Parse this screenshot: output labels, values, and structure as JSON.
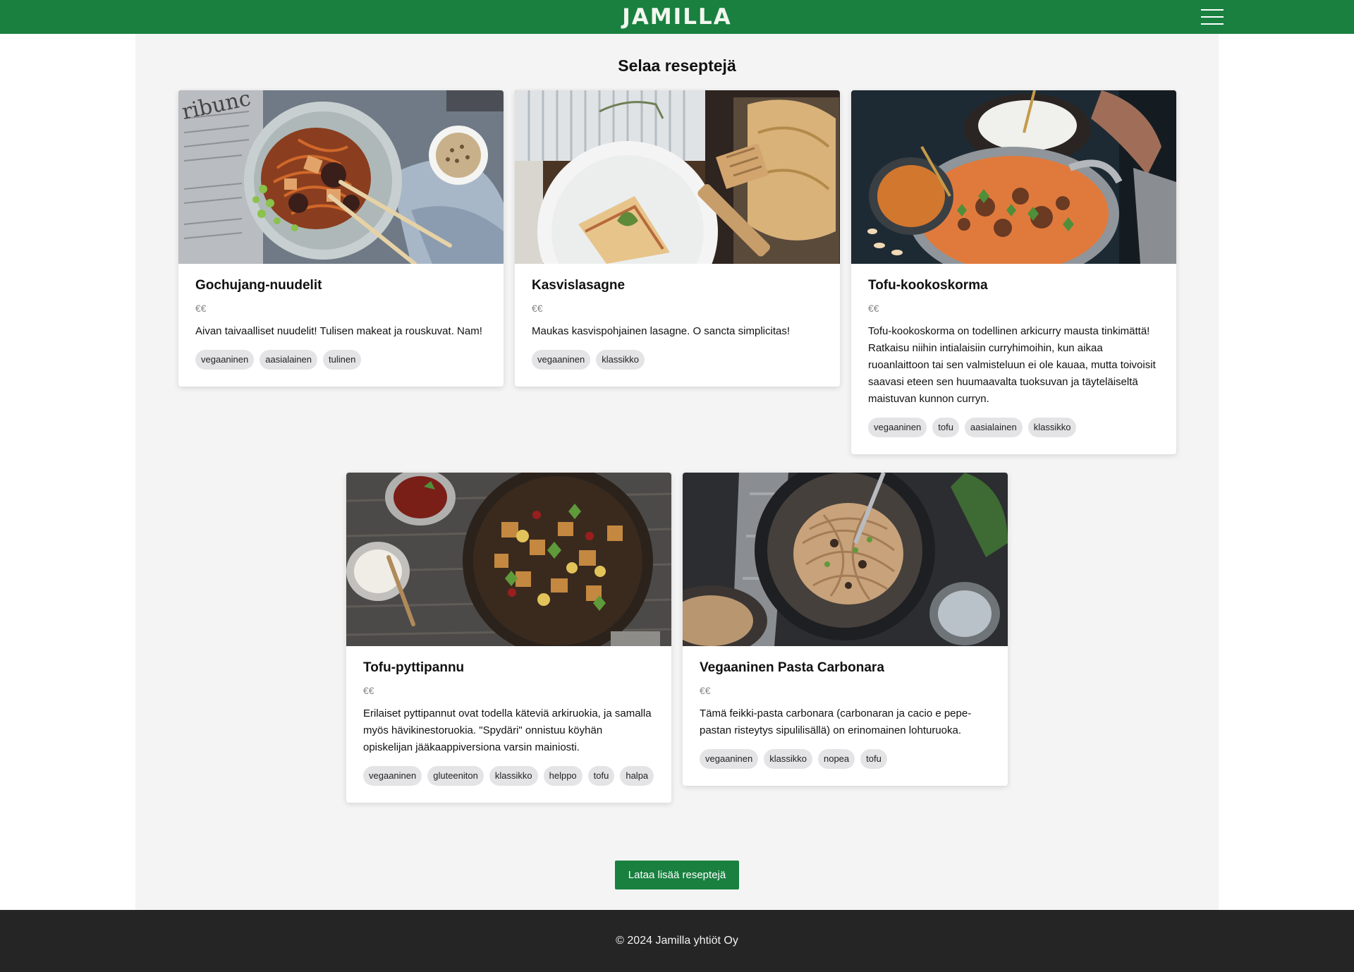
{
  "header": {
    "logo": "JAMILLA",
    "menu_icon": "hamburger-menu-icon",
    "background": "#198040"
  },
  "main": {
    "title": "Selaa reseptejä",
    "load_more_label": "Lataa lisää reseptejä",
    "recipes": [
      {
        "title": "Gochujang-nuudelit",
        "price": "€€",
        "description": "Aivan taivaalliset nuudelit! Tulisen makeat ja rouskuvat. Nam!",
        "tags": [
          "vegaaninen",
          "aasialainen",
          "tulinen"
        ]
      },
      {
        "title": "Kasvislasagne",
        "price": "€€",
        "description": "Maukas kasvispohjainen lasagne. O sancta simplicitas!",
        "tags": [
          "vegaaninen",
          "klassikko"
        ]
      },
      {
        "title": "Tofu-kookoskorma",
        "price": "€€",
        "description": "Tofu-kookoskorma on todellinen arkicurry mausta tinkimättä! Ratkaisu niihin intialaisiin curryhimoihin, kun aikaa ruoanlaittoon tai sen valmisteluun ei ole kauaa, mutta toivoisit saavasi eteen sen huumaavalta tuoksuvan ja täyteläiseltä maistuvan kunnon curryn.",
        "tags": [
          "vegaaninen",
          "tofu",
          "aasialainen",
          "klassikko"
        ]
      },
      {
        "title": "Tofu-pyttipannu",
        "price": "€€",
        "description": "Erilaiset pyttipannut ovat todella käteviä arkiruokia, ja samalla myös hävikinestoruokia. \"Spydäri\" onnistuu köyhän opiskelijan jääkaappiversiona varsin mainiosti.",
        "tags": [
          "vegaaninen",
          "gluteeniton",
          "klassikko",
          "helppo",
          "tofu",
          "halpa"
        ]
      },
      {
        "title": "Vegaaninen Pasta Carbonara",
        "price": "€€",
        "description": "Tämä feikki-pasta carbonara (carbonaran ja cacio e pepe-pastan risteytys sipulilisällä) on erinomainen lohturuoka.",
        "tags": [
          "vegaaninen",
          "klassikko",
          "nopea",
          "tofu"
        ]
      }
    ]
  },
  "footer": {
    "text": "© 2024 Jamilla yhtiöt Oy"
  }
}
